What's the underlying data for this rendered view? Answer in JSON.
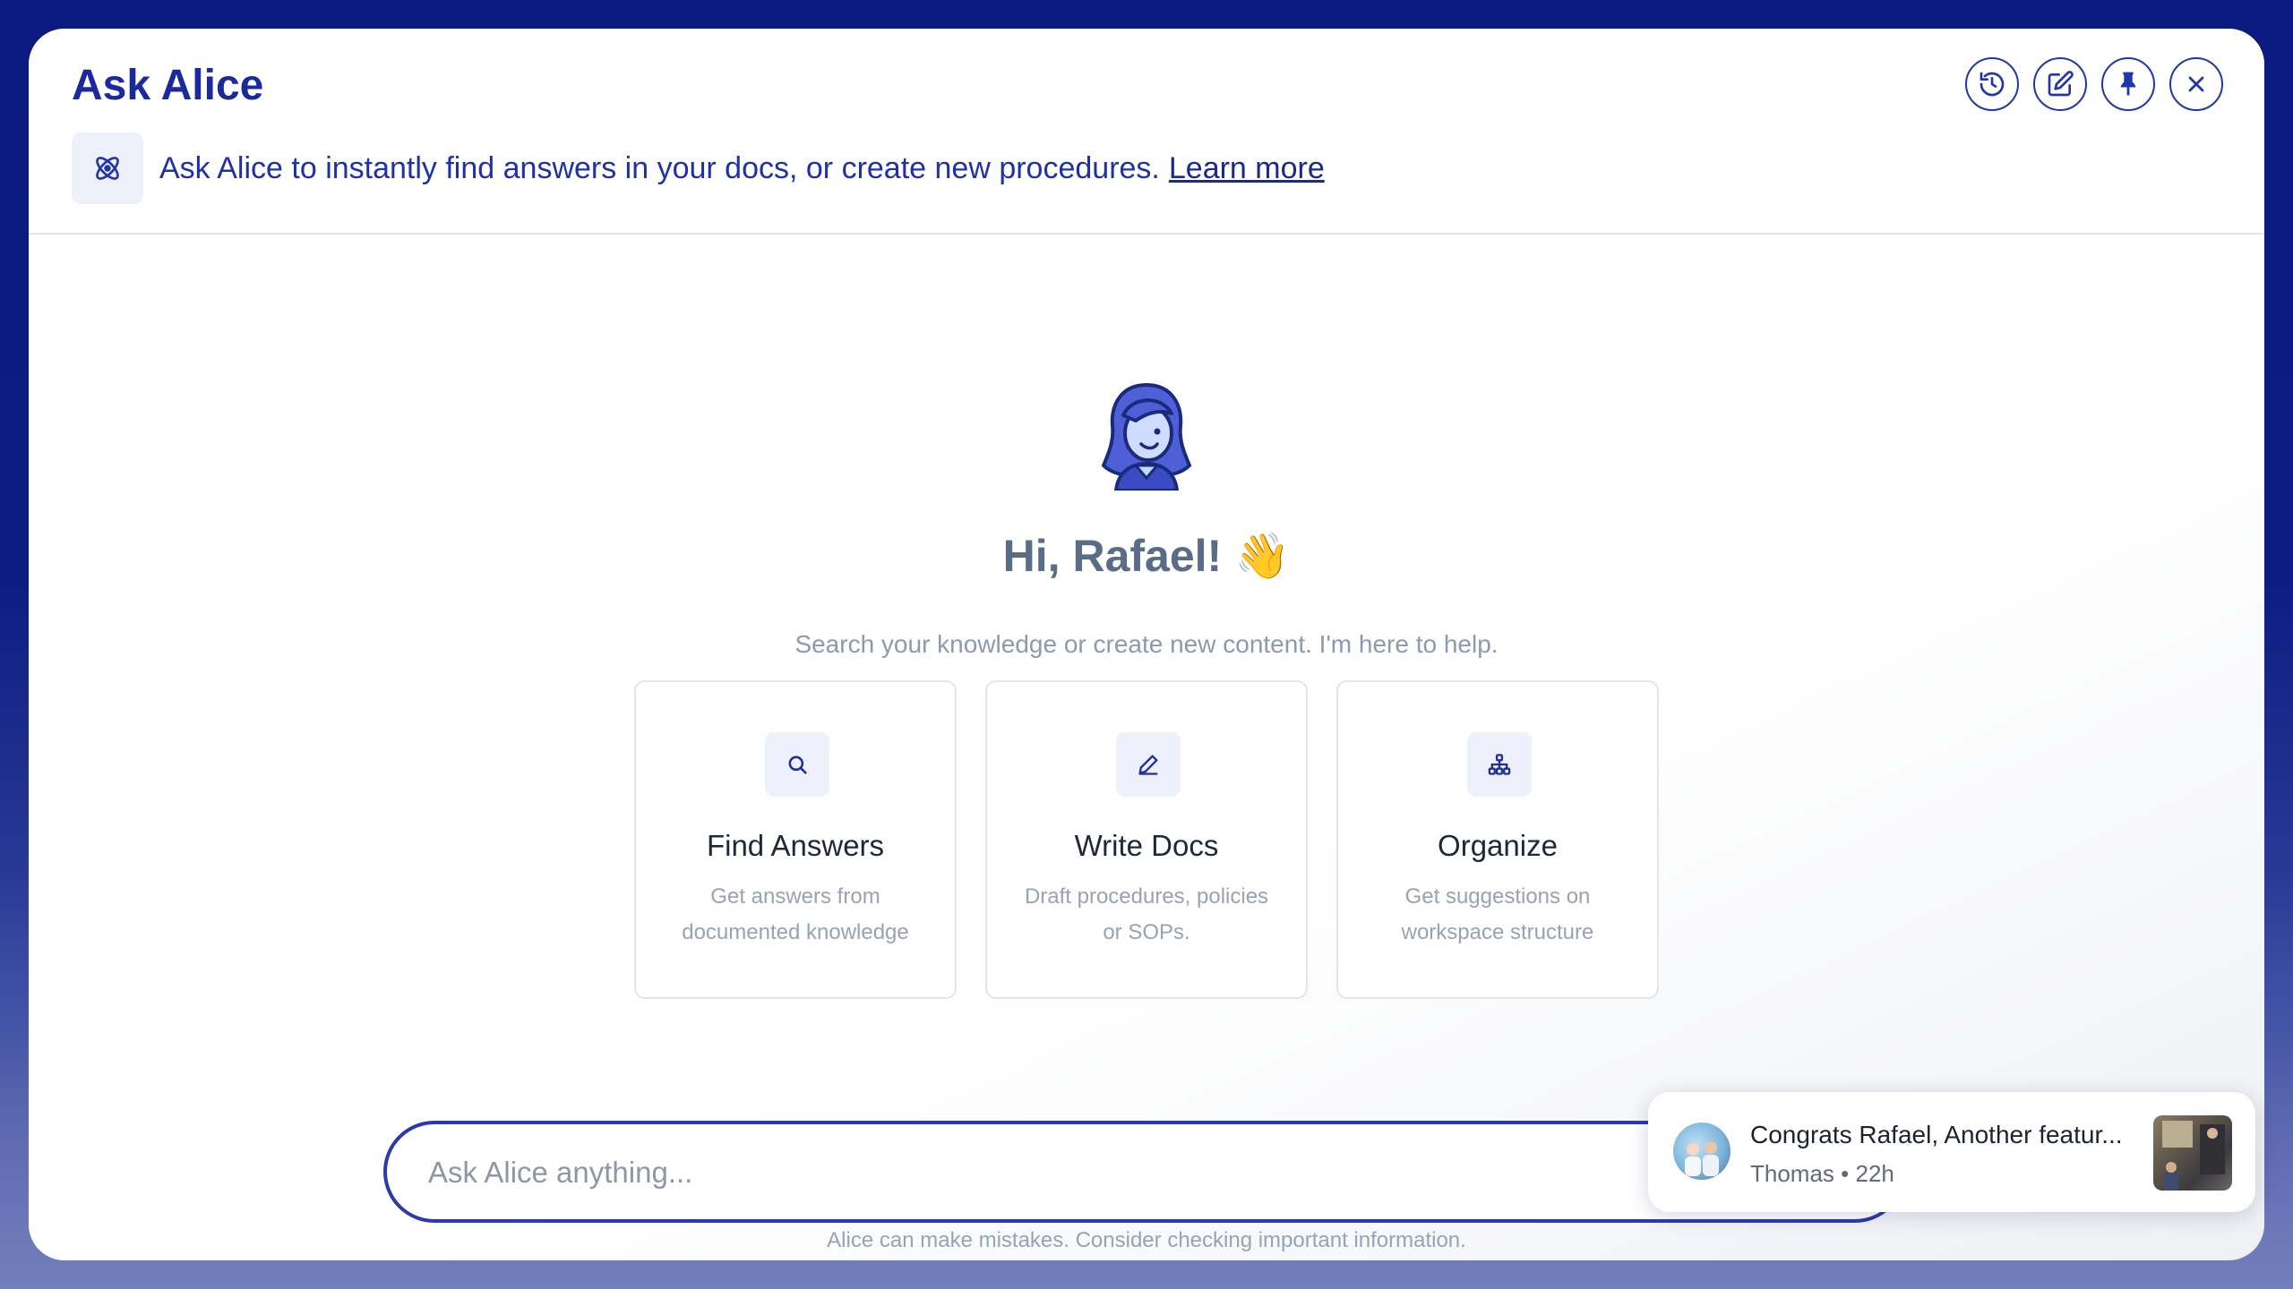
{
  "header": {
    "title": "Ask Alice",
    "actions": [
      {
        "name": "history-icon",
        "label": "History"
      },
      {
        "name": "edit-icon",
        "label": "New chat"
      },
      {
        "name": "pin-icon",
        "label": "Pin"
      },
      {
        "name": "close-icon",
        "label": "Close"
      }
    ]
  },
  "banner": {
    "icon": "atom-icon",
    "text": "Ask Alice to instantly find answers in your docs, or create new procedures.",
    "link": "Learn more"
  },
  "welcome": {
    "avatar": "alice-avatar",
    "greeting": "Hi, Rafael! 👋",
    "subtitle": "Search your knowledge or create new content. I'm here to help."
  },
  "cards": [
    {
      "icon": "search-icon",
      "title": "Find Answers",
      "desc": "Get answers from documented knowledge"
    },
    {
      "icon": "pencil-icon",
      "title": "Write Docs",
      "desc": "Draft procedures, policies or SOPs."
    },
    {
      "icon": "hierarchy-icon",
      "title": "Organize",
      "desc": "Get suggestions on workspace structure"
    }
  ],
  "input": {
    "placeholder": "Ask Alice anything..."
  },
  "disclaimer": "Alice can make mistakes. Consider checking important information.",
  "toast": {
    "title": "Congrats Rafael, Another featur...",
    "author": "Thomas",
    "time": "22h",
    "separator": "•"
  },
  "colors": {
    "accent": "#1a2a9c",
    "background": "#0b1a7e",
    "muted_text": "#96a3b5"
  }
}
